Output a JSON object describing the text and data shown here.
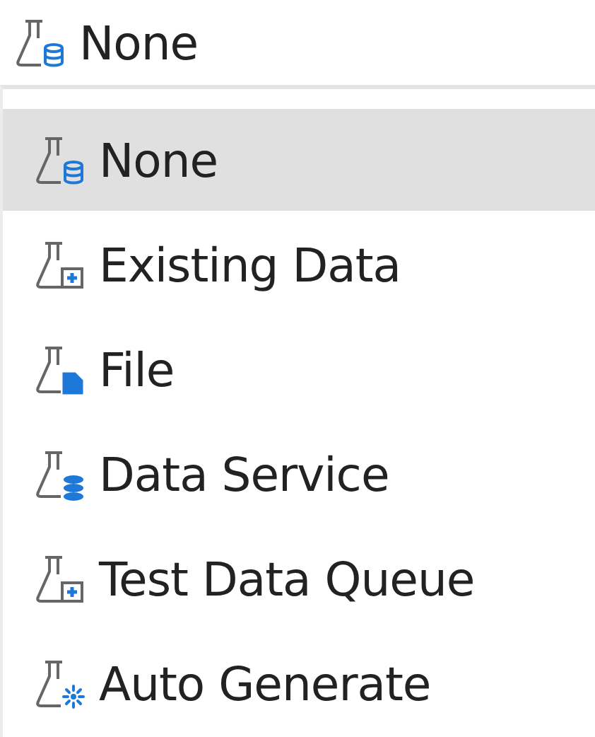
{
  "selected_value": {
    "label": "None",
    "kind": "cylinder"
  },
  "options": [
    {
      "label": "None",
      "kind": "cylinder",
      "selected": true
    },
    {
      "label": "Existing Data",
      "kind": "box",
      "selected": false
    },
    {
      "label": "File",
      "kind": "file",
      "selected": false
    },
    {
      "label": "Data Service",
      "kind": "stack",
      "selected": false
    },
    {
      "label": "Test Data Queue",
      "kind": "box",
      "selected": false
    },
    {
      "label": "Auto Generate",
      "kind": "sparkle",
      "selected": false
    }
  ]
}
